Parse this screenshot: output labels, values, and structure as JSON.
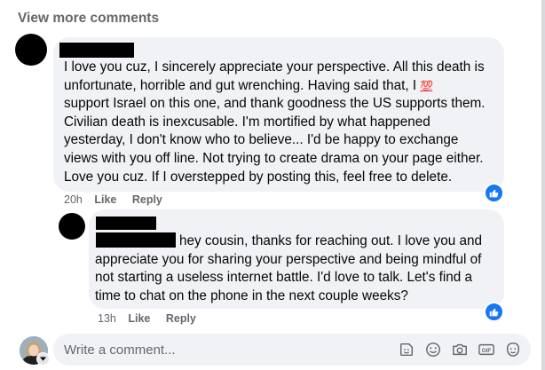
{
  "view_more_label": "View more comments",
  "comments": [
    {
      "text": "I love you cuz, I sincerely appreciate your perspective. All this death is\nunfortunate, horrible and gut wrenching. Having said that, I ",
      "emoji": "💯",
      "text_after_emoji": "\nsupport Israel on this one, and thank goodness the US supports them.\nCivilian death is inexcusable. I'm mortified by what happened\nyesterday, I don't know who to believe... I'd be happy to exchange\nviews with you off line. Not trying to create drama on your page either.\nLove you cuz. If I overstepped by posting this, feel free to delete.",
      "time": "20h",
      "like_label": "Like",
      "reply_label": "Reply"
    },
    {
      "text": "hey cousin, thanks for reaching out. I love you and\nappreciate you for sharing your perspective and being mindful of\nnot starting a useless internet battle. I'd love to talk. Let's find a\ntime to chat on the phone in the next couple weeks?",
      "time": "13h",
      "like_label": "Like",
      "reply_label": "Reply"
    }
  ],
  "composer": {
    "placeholder": "Write a comment...",
    "gif_label": "GIF"
  },
  "icons": [
    "like-icon",
    "sticker-icon",
    "emoji-icon",
    "camera-icon",
    "gif-icon",
    "avatar-sticker-icon",
    "chevron-down-icon"
  ],
  "colors": {
    "bubble": "#f0f2f5",
    "meta": "#65676b",
    "like_blue": "#1877f2"
  }
}
